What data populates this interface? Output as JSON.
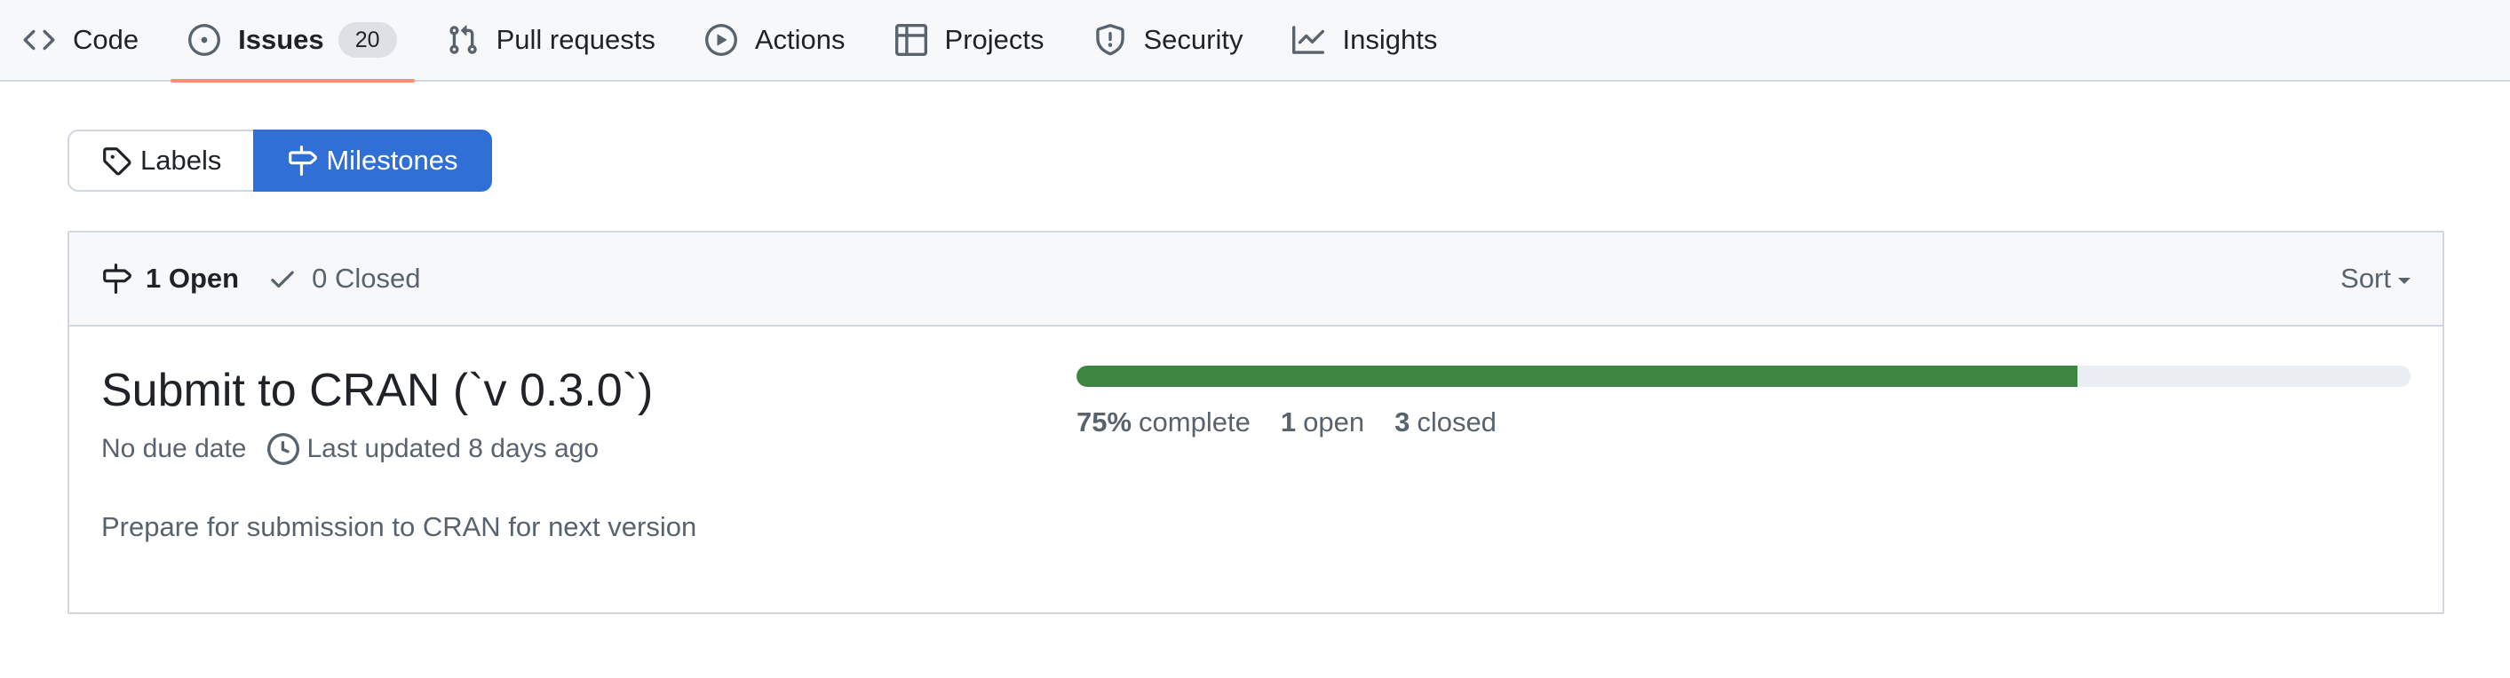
{
  "nav": {
    "code": "Code",
    "issues": "Issues",
    "issues_count": "20",
    "pull_requests": "Pull requests",
    "actions": "Actions",
    "projects": "Projects",
    "security": "Security",
    "insights": "Insights",
    "selected": "issues",
    "selected_underline_color": "#fd8c73"
  },
  "subnav": {
    "labels": "Labels",
    "milestones": "Milestones",
    "active": "milestones",
    "active_color": "#2f6fd6"
  },
  "filter": {
    "open_label": "1 Open",
    "closed_label": "0 Closed",
    "sort_label": "Sort"
  },
  "milestone": {
    "title": "Submit to CRAN (`v 0.3.0`)",
    "due": "No due date",
    "updated": "Last updated 8 days ago",
    "description": "Prepare for submission to CRAN for next version",
    "percent_complete": 75,
    "percent_text": "75%",
    "complete_label": "complete",
    "open_count": "1",
    "open_label": "open",
    "closed_count": "3",
    "closed_label": "closed",
    "progress_color": "#3f8542"
  },
  "icons": [
    "code-icon",
    "issue-opened-icon",
    "pull-request-icon",
    "play-icon",
    "table-icon",
    "shield-icon",
    "graph-icon",
    "tag-icon",
    "milestone-icon",
    "check-icon",
    "clock-icon",
    "caret-down-icon"
  ]
}
